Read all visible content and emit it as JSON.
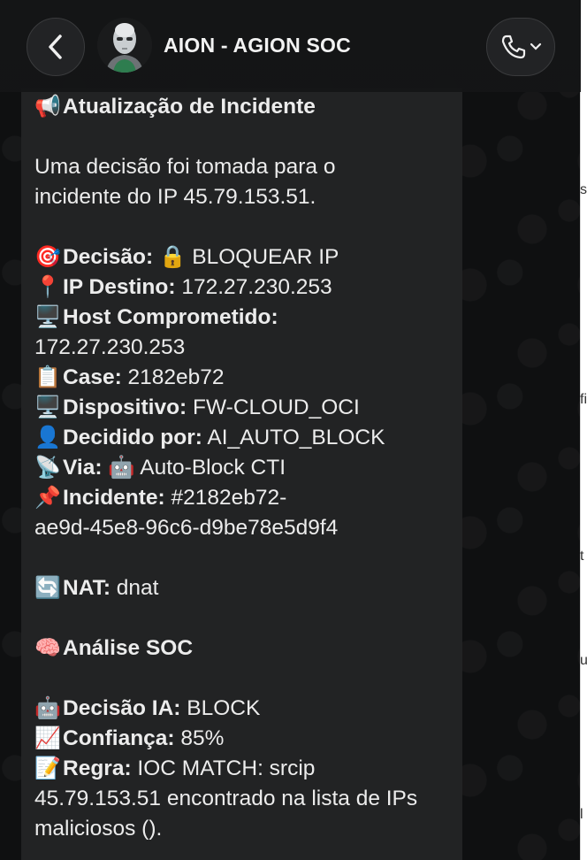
{
  "header": {
    "title": "AION - AGION SOC",
    "back_icon": "chevron-left-icon",
    "call_icon": "phone-icon",
    "avatar": "robot-avatar"
  },
  "message": {
    "title_emoji": "📢",
    "title": "Atualização de Incidente",
    "intro_1": "Uma decisão foi tomada para o",
    "intro_2": "incidente do IP 45.79.153.51.",
    "decisao": {
      "emoji": "🎯",
      "label": "Decisão:",
      "value": "🔒 BLOQUEAR IP"
    },
    "ip_destino": {
      "emoji": "📍",
      "label": "IP Destino:",
      "value": "172.27.230.253"
    },
    "host": {
      "emoji": "🖥️",
      "label": "Host Comprometido:",
      "value": "172.27.230.253"
    },
    "case": {
      "emoji": "📋",
      "label": "Case:",
      "value": "2182eb72"
    },
    "dispositivo": {
      "emoji": "🖥️",
      "label": "Dispositivo:",
      "value": "FW-CLOUD_OCI"
    },
    "decidido": {
      "emoji": "👤",
      "label": "Decidido por:",
      "value": "AI_AUTO_BLOCK"
    },
    "via": {
      "emoji": "📡",
      "label": "Via:",
      "value": "🤖 Auto-Block CTI"
    },
    "incidente": {
      "emoji": "📌",
      "label": "Incidente:",
      "value_1": "#2182eb72-",
      "value_2": "ae9d-45e8-96c6-d9be78e5d9f4"
    },
    "nat": {
      "emoji": "🔄",
      "label": "NAT:",
      "value": "dnat"
    },
    "analise": {
      "emoji": "🧠",
      "label": "Análise SOC"
    },
    "decisao_ia": {
      "emoji": "🤖",
      "label": "Decisão IA:",
      "value": "BLOCK"
    },
    "confianca": {
      "emoji": "📈",
      "label": "Confiança:",
      "value": "85%"
    },
    "regra": {
      "emoji": "📝",
      "label": "Regra:",
      "value_1": "IOC MATCH: srcip",
      "value_2": "45.79.153.51 encontrado na lista de IPs",
      "value_3": "maliciosos ()."
    }
  },
  "right_strip": [
    "s",
    "fi",
    "t",
    "u",
    "l"
  ]
}
